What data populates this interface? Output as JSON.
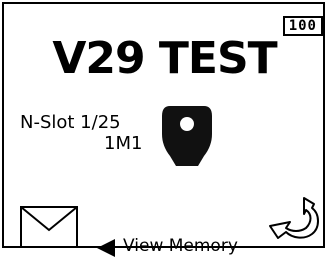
{
  "screen": {
    "badge": "100",
    "title": "V29 TEST",
    "slot_text": "N-Slot 1/25",
    "code_text": "1M1"
  },
  "footer": {
    "view_memory_label": "View Memory"
  },
  "icons": {
    "key": "key-icon",
    "mail": "envelope-icon",
    "left_arrow": "left-triangle-icon",
    "back": "back-arrow-icon"
  }
}
